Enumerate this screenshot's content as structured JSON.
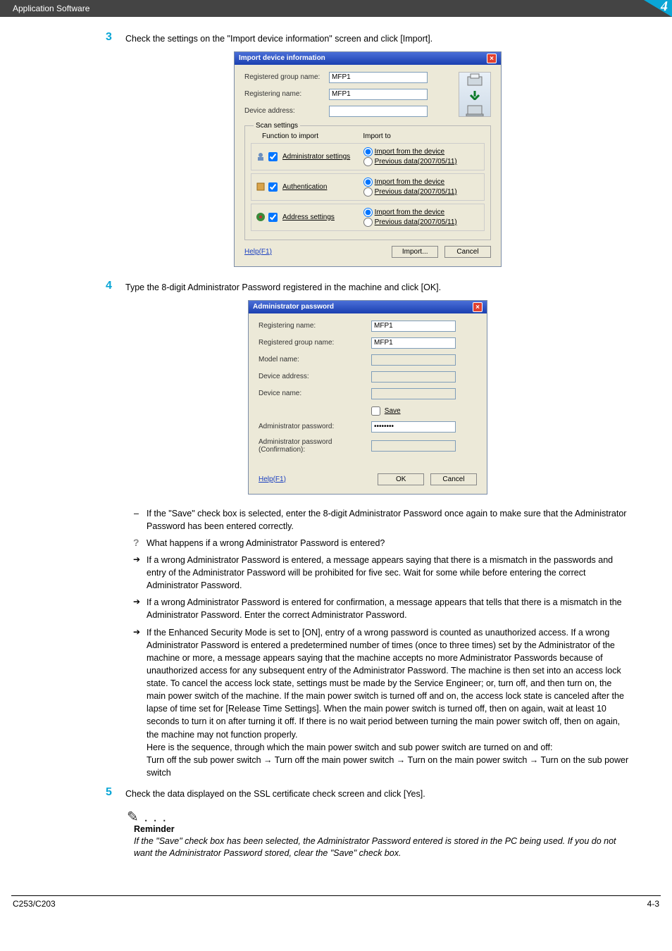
{
  "header": {
    "section": "Application Software",
    "chapter_number": "4"
  },
  "step3": {
    "num": "3",
    "text": "Check the settings on the \"Import device information\" screen and click [Import]."
  },
  "dlg1": {
    "title": "Import device information",
    "reg_group_label": "Registered group name:",
    "reg_group_value": "MFP1",
    "reg_name_label": "Registering name:",
    "reg_name_value": "MFP1",
    "dev_addr_label": "Device address:",
    "dev_addr_value": "",
    "scan_title": "Scan settings",
    "col_func": "Function to import",
    "col_to": "Import to",
    "row1_label": "Administrator settings",
    "row2_label": "Authentication",
    "row3_label": "Address settings",
    "opt_device": "Import from the device",
    "opt_prev": "Previous data(2007/05/11)",
    "help": "Help(F1)",
    "btn_import": "Import...",
    "btn_cancel": "Cancel"
  },
  "step4": {
    "num": "4",
    "text": "Type the 8-digit Administrator Password registered in the machine and click [OK]."
  },
  "dlg2": {
    "title": "Administrator password",
    "reg_name_label": "Registering name:",
    "reg_name_value": "MFP1",
    "reg_group_label": "Registered group name:",
    "reg_group_value": "MFP1",
    "model_label": "Model name:",
    "dev_addr_label": "Device address:",
    "dev_name_label": "Device name:",
    "save_label": "Save",
    "admin_pw_label": "Administrator password:",
    "admin_pw_value": "••••••••",
    "admin_pw_conf_label": "Administrator password (Confirmation):",
    "help": "Help(F1)",
    "btn_ok": "OK",
    "btn_cancel": "Cancel"
  },
  "notes": {
    "n1": "If the \"Save\" check box is selected, enter the 8-digit Administrator Password once again to make sure that the Administrator Password has been entered correctly.",
    "n2": "What happens if a wrong Administrator Password is entered?",
    "n3": "If a wrong Administrator Password is entered, a message appears saying that there is a mismatch in the passwords and entry of the Administrator Password will be prohibited for five sec. Wait for some while before entering the correct Administrator Password.",
    "n4": "If a wrong Administrator Password is entered for confirmation, a message appears that tells that there is a mismatch in the Administrator Password. Enter the correct Administrator Password.",
    "n5": "If the Enhanced Security Mode is set to [ON], entry of a wrong password is counted as unauthorized access. If a wrong Administrator Password is entered a predetermined number of times (once to three times) set by the Administrator of the machine or more, a message appears saying that the machine accepts no more Administrator Passwords because of unauthorized access for any subsequent entry of the Administrator Password. The machine is then set into an access lock state. To cancel the access lock state, settings must be made by the Service Engineer; or, turn off, and then turn on, the main power switch of the machine. If the main power switch is turned off and on, the access lock state is canceled after the lapse of time set for [Release Time Settings]. When the main power switch is turned off, then on again, wait at least 10 seconds to turn it on after turning it off. If there is no wait period between turning the main power switch off, then on again, the machine may not function properly.",
    "n5b": "Here is the sequence, through which the main power switch and sub power switch are turned on and off:",
    "n5c": "Turn off the sub power switch → Turn off the main power switch → Turn on the main power switch → Turn on the sub power switch"
  },
  "step5": {
    "num": "5",
    "text": "Check the data displayed on the SSL certificate check screen and click [Yes]."
  },
  "reminder": {
    "icon": "✎ . . .",
    "title": "Reminder",
    "body": "If the \"Save\" check box has been selected, the Administrator Password entered is stored in the PC being used. If you do not want the Administrator Password stored, clear the \"Save\" check box."
  },
  "footer": {
    "left": "C253/C203",
    "right": "4-3"
  }
}
